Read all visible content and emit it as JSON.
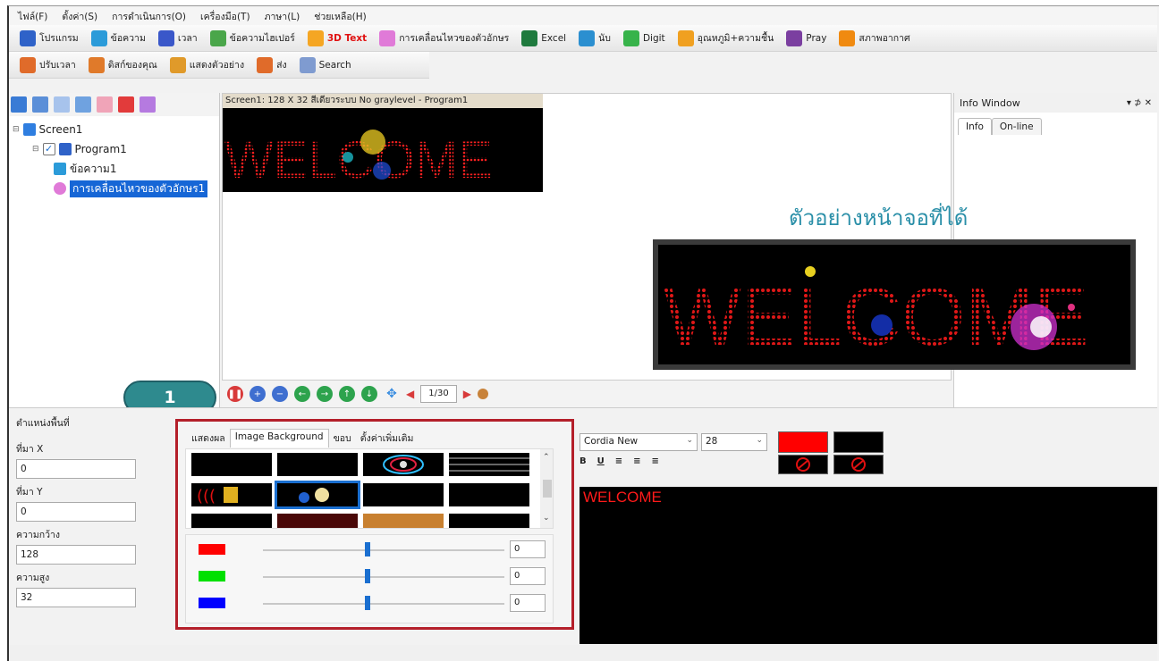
{
  "menu": [
    "ไฟล์(F)",
    "ตั้งค่า(S)",
    "การดำเนินการ(O)",
    "เครื่องมือ(T)",
    "ภาษา(L)",
    "ช่วยเหลือ(H)"
  ],
  "toolbar1": [
    {
      "label": "โปรแกรม",
      "icon": "program-icon",
      "color": "#2f62c8"
    },
    {
      "label": "ข้อความ",
      "icon": "text-icon",
      "color": "#2b9bd9"
    },
    {
      "label": "เวลา",
      "icon": "clock-icon",
      "color": "#3a57c9"
    },
    {
      "label": "ข้อความไฮเปอร์",
      "icon": "hyper-text-icon",
      "color": "#4aa64a"
    },
    {
      "label": "3D Text",
      "icon": "3d-cube-icon",
      "color": "#f5a623"
    },
    {
      "label": "การเคลื่อนไหวของตัวอักษร",
      "icon": "animation-icon",
      "color": "#e07ad8"
    },
    {
      "label": "Excel",
      "icon": "excel-icon",
      "color": "#1f7a3e"
    },
    {
      "label": "นับ",
      "icon": "counter-icon",
      "color": "#2b8fd0"
    },
    {
      "label": "Digit",
      "icon": "digit-icon",
      "color": "#37b34a"
    },
    {
      "label": "อุณหภูมิ+ความชื้น",
      "icon": "thermometer-icon",
      "color": "#f0a020"
    },
    {
      "label": "Pray",
      "icon": "pray-icon",
      "color": "#7b3fa0"
    },
    {
      "label": "สภาพอากาศ",
      "icon": "weather-icon",
      "color": "#f08a10"
    }
  ],
  "toolbar2": [
    {
      "label": "ปรับเวลา",
      "icon": "adjust-time-icon",
      "color": "#e06b2a"
    },
    {
      "label": "ดิสก์ของคุณ",
      "icon": "disk-icon",
      "color": "#e07a2a"
    },
    {
      "label": "แสดงตัวอย่าง",
      "icon": "preview-icon",
      "color": "#e09a2a"
    },
    {
      "label": "ส่ง",
      "icon": "send-icon",
      "color": "#e06b2a"
    },
    {
      "label": "Search",
      "icon": "search-icon",
      "color": "#7f9bd0"
    }
  ],
  "tree": {
    "screen": "Screen1",
    "program": "Program1",
    "item_text": "ข้อความ1",
    "item_anim": "การเคลื่อนไหวของตัวอักษร1"
  },
  "preview": {
    "title": "Screen1: 128 X 32  สีเดียวระบบ No graylevel - Program1",
    "led_text": "WELCOME",
    "page": "1/30"
  },
  "info": {
    "title": "Info Window",
    "pin": "▾ ⊅ ✕",
    "tabs": [
      "Info",
      "On-line"
    ]
  },
  "caption": "ตัวอย่างหน้าจอที่ได้",
  "badge": "1",
  "position": {
    "title": "ตำแหน่งพื้นที่",
    "x_label": "ที่มา X",
    "x_value": "0",
    "y_label": "ที่มา Y",
    "y_value": "0",
    "w_label": "ความกว้าง",
    "w_value": "128",
    "h_label": "ความสูง",
    "h_value": "32"
  },
  "effect_tabs": [
    "แสดงผล",
    "Image Background",
    "ขอบ",
    "ตั้งค่าเพิ่มเติม"
  ],
  "sliders": [
    {
      "color": "#ff0000",
      "value": "0"
    },
    {
      "color": "#00e000",
      "value": "0"
    },
    {
      "color": "#0000ff",
      "value": "0"
    }
  ],
  "editor": {
    "font": "Cordia New",
    "size": "28",
    "format_buttons": [
      "B",
      "U",
      "≡",
      "≡",
      "≡"
    ],
    "fg_color": "#ff0000",
    "bg_color": "#000000",
    "text": "WELCOME"
  }
}
